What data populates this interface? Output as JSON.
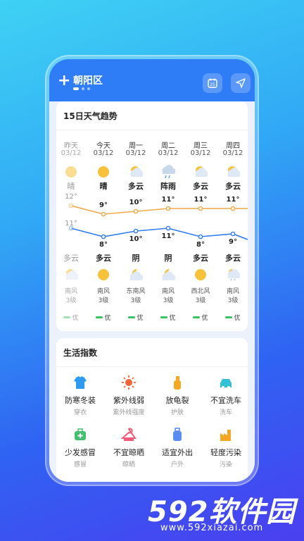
{
  "header": {
    "city": "朝阳区"
  },
  "trend": {
    "title": "15日天气趋势",
    "days": [
      {
        "day": "昨天",
        "date": "03/12",
        "cond_day": "晴",
        "high": "12°",
        "low": "11°",
        "cond_night": "多云",
        "wind_dir": "南风",
        "wind_lvl": "3级",
        "aqi": "优",
        "past": true,
        "icon_day": "sun",
        "icon_night": "cloud-sun"
      },
      {
        "day": "今天",
        "date": "03/12",
        "cond_day": "晴",
        "high": "9°",
        "low": "8°",
        "cond_night": "多云",
        "wind_dir": "南风",
        "wind_lvl": "3级",
        "aqi": "优",
        "past": false,
        "icon_day": "sun",
        "icon_night": "sun"
      },
      {
        "day": "周一",
        "date": "03/12",
        "cond_day": "多云",
        "high": "10°",
        "low": "10°",
        "cond_night": "阴",
        "wind_dir": "东南风",
        "wind_lvl": "3级",
        "aqi": "优",
        "past": false,
        "icon_day": "cloud-sun",
        "icon_night": "moon-cloud"
      },
      {
        "day": "周二",
        "date": "03/12",
        "cond_day": "阵雨",
        "high": "11°",
        "low": "11°",
        "cond_night": "阴",
        "wind_dir": "南风",
        "wind_lvl": "3级",
        "aqi": "优",
        "past": false,
        "icon_day": "rain-cloud",
        "icon_night": "moon-cloud"
      },
      {
        "day": "周三",
        "date": "03/12",
        "cond_day": "多云",
        "high": "11°",
        "low": "8°",
        "cond_night": "多云",
        "wind_dir": "西北风",
        "wind_lvl": "3级",
        "aqi": "优",
        "past": false,
        "icon_day": "cloud-sun",
        "icon_night": "sun"
      },
      {
        "day": "周四",
        "date": "03/12",
        "cond_day": "多云",
        "high": "11°",
        "low": "9°",
        "cond_night": "多云",
        "wind_dir": "南风",
        "wind_lvl": "3级",
        "aqi": "优",
        "past": false,
        "icon_day": "cloud-sun",
        "icon_night": "snow-cloud"
      }
    ],
    "highs": [
      12,
      9,
      10,
      11,
      11,
      11
    ],
    "lows": [
      11,
      8,
      10,
      11,
      8,
      9
    ]
  },
  "life": {
    "title": "生活指数",
    "items": [
      {
        "name": "防寒冬装",
        "sub": "穿衣",
        "icon": "shirt-icon",
        "color": "#2d9cf0"
      },
      {
        "name": "紫外线弱",
        "sub": "紫外线强度",
        "icon": "sun-rays-icon",
        "color": "#f0663a"
      },
      {
        "name": "放龟裂",
        "sub": "护肤",
        "icon": "lotion-icon",
        "color": "#f7a823"
      },
      {
        "name": "不宜洗车",
        "sub": "洗车",
        "icon": "car-icon",
        "color": "#33c1d6"
      },
      {
        "name": "少发感冒",
        "sub": "感冒",
        "icon": "medkit-icon",
        "color": "#43c06b"
      },
      {
        "name": "不宜晾晒",
        "sub": "晾晒",
        "icon": "hanger-icon",
        "color": "#ef5d7a"
      },
      {
        "name": "适宜外出",
        "sub": "户外",
        "icon": "luggage-icon",
        "color": "#5b8cf2"
      },
      {
        "name": "轻度污染",
        "sub": "污染",
        "icon": "factory-icon",
        "color": "#f5a623"
      }
    ]
  },
  "colors": {
    "high_line": "#f3a848",
    "low_line": "#2f7bf0",
    "accent": "#2e7df6"
  },
  "watermark": {
    "brand": "592软件园",
    "url": "www.592xiazai.com"
  }
}
